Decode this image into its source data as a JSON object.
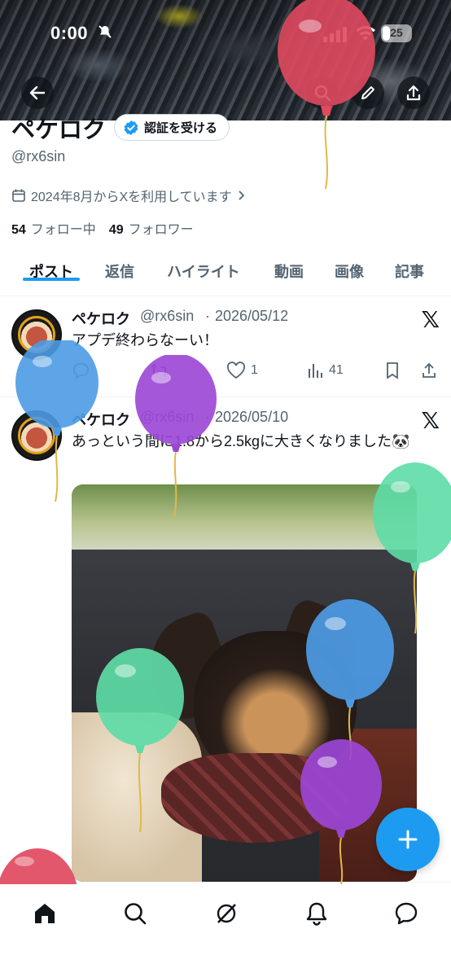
{
  "status": {
    "time": "0:00",
    "battery": "25"
  },
  "profile": {
    "name": "ペケロク",
    "verify_label": "認証を受ける",
    "handle": "@rx6sin",
    "joined": "2024年8月からXを利用しています",
    "following_count": "54",
    "following_label": "フォロー中",
    "followers_count": "49",
    "followers_label": "フォロワー"
  },
  "tabs": [
    {
      "label": "ポスト"
    },
    {
      "label": "返信"
    },
    {
      "label": "ハイライト"
    },
    {
      "label": "動画"
    },
    {
      "label": "画像"
    },
    {
      "label": "記事"
    }
  ],
  "posts": [
    {
      "name": "ペケロク",
      "handle": "@rx6sin",
      "sep": "·",
      "date": "2026/05/12",
      "text": "アプデ終わらなーい！",
      "likes": "1",
      "views": "41"
    },
    {
      "name": "ペケロク",
      "handle": "@rx6sin",
      "sep": "·",
      "date": "2026/05/10",
      "text": "あっという間に1.8から2.5kgに大きくなりました🐼"
    }
  ],
  "icons": {
    "back": "back-arrow-icon",
    "search": "search-icon",
    "edit": "pencil-icon",
    "share": "share-icon",
    "x_logo": "x-logo-icon"
  },
  "colors": {
    "accent": "#1d9bf0",
    "text": "#0f1419",
    "muted": "#536471"
  },
  "balloons": [
    "red",
    "blue",
    "purple",
    "green",
    "blue",
    "green",
    "purple",
    "red"
  ]
}
